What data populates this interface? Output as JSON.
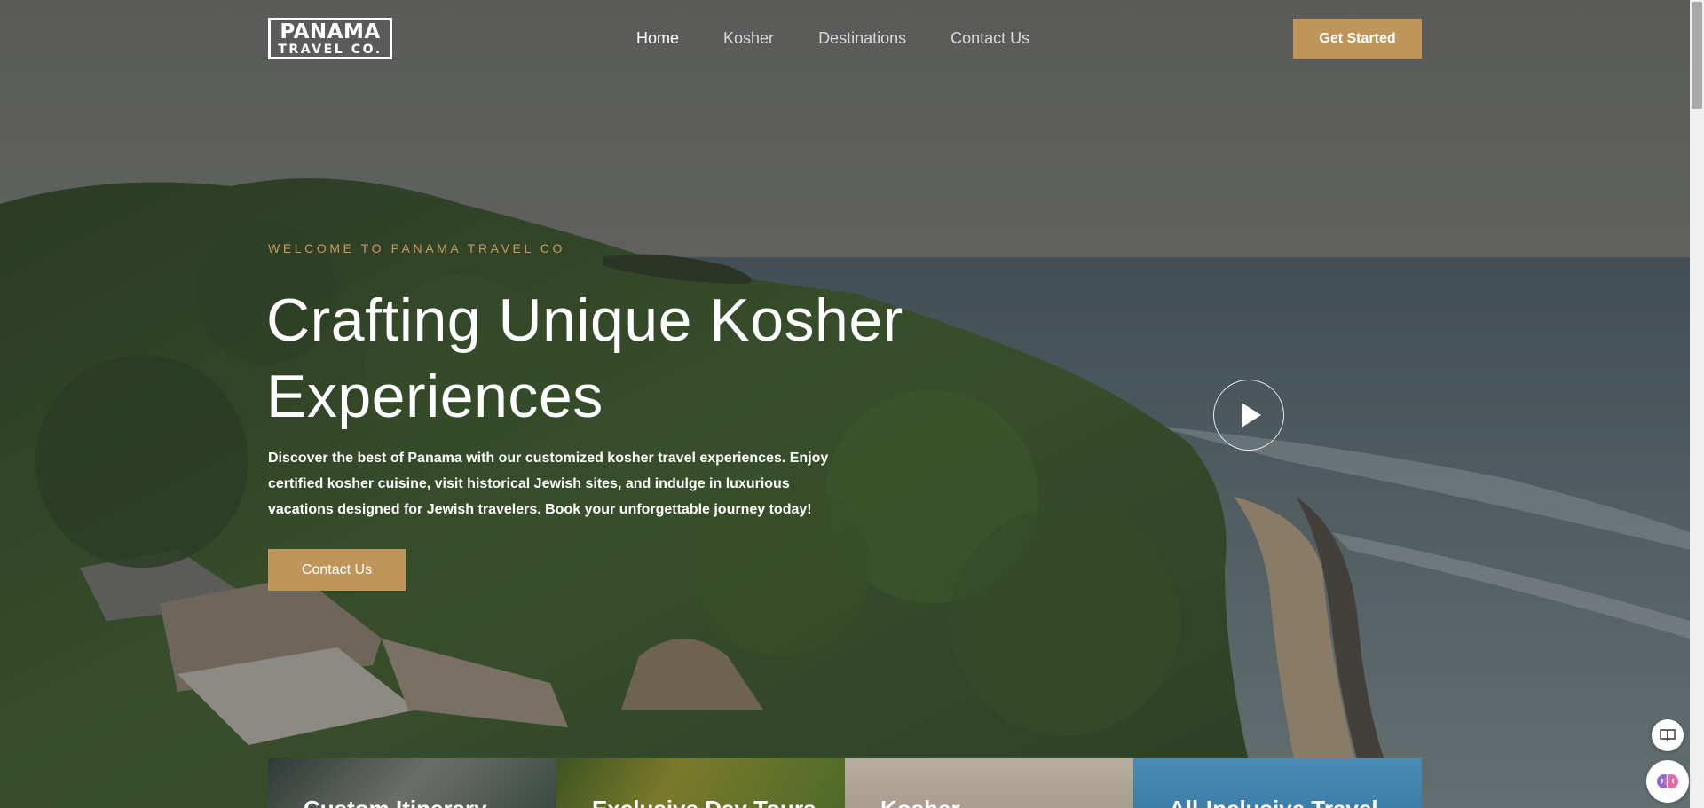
{
  "header": {
    "logo_top": "PANAMA",
    "logo_bottom": "TRAVEL CO.",
    "nav": [
      {
        "label": "Home",
        "active": true
      },
      {
        "label": "Kosher",
        "active": false
      },
      {
        "label": "Destinations",
        "active": false
      },
      {
        "label": "Contact Us",
        "active": false
      }
    ],
    "cta_label": "Get Started"
  },
  "hero": {
    "eyebrow": "WELCOME TO PANAMA TRAVEL CO",
    "headline_line1": "Crafting Unique Kosher",
    "headline_line2": "Experiences",
    "subtext": "Discover the best of Panama with our customized kosher travel experiences. Enjoy certified kosher cuisine, visit historical Jewish sites, and indulge in luxurious vacations designed for Jewish travelers. Book your unforgettable journey today!",
    "contact_label": "Contact Us",
    "play_icon": "play-icon"
  },
  "cards": [
    {
      "title": "Custom Itinerary"
    },
    {
      "title": "Exclusive Day Tours"
    },
    {
      "title": "Kosher"
    },
    {
      "title": "All-Inclusive Travel"
    }
  ],
  "colors": {
    "accent": "#c0955a",
    "eyebrow": "#c79a5e"
  },
  "widgets": {
    "reader_icon": "book-icon",
    "assistant_icon": "ai-brain-icon"
  }
}
